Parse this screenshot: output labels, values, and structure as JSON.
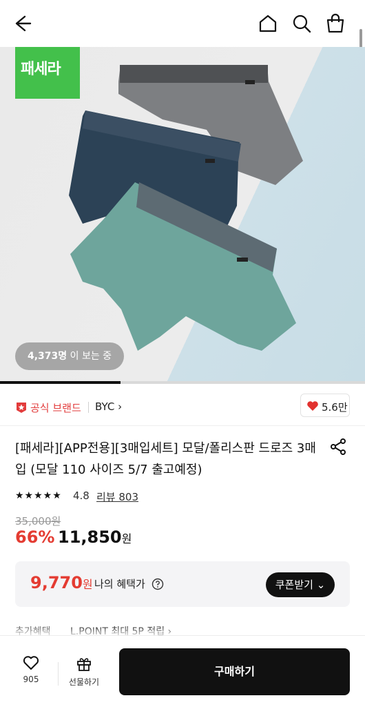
{
  "topbar": {
    "back_icon": "arrow-left-icon",
    "home_icon": "home-icon",
    "search_icon": "search-icon",
    "cart_icon": "shopping-bag-icon"
  },
  "hero": {
    "badge_text": "패세라",
    "badge_color": "#43c04b",
    "viewer_count": "4,373명",
    "viewer_suffix": " 이 보는 중",
    "image_progress": 0.33
  },
  "brand": {
    "official_label": "공식 브랜드",
    "official_color": "#e23b3b",
    "name": "BYC",
    "chevron": "›",
    "like_count": "5.6만",
    "heart_color": "#e2322f"
  },
  "product": {
    "title": "[패세라][APP전용][3매입세트] 모달/폴리스판 드로즈 3매입 (모달 110 사이즈 5/7 출고예정)",
    "rating_stars": "★★★★★",
    "rating_value": "4.8",
    "review_text": "리뷰 803",
    "original_price": "35,000원",
    "discount_rate": "66%",
    "sale_price": "11,850",
    "currency": "원",
    "accent_color": "#e43c32"
  },
  "benefit": {
    "price": "9,770",
    "currency": "원",
    "label": "나의 혜택가",
    "coupon_button": "쿠폰받기"
  },
  "extra": {
    "label": "추가혜택",
    "value": "L.POINT 최대 5P 적립 ›"
  },
  "bottom_bar": {
    "wish_count": "905",
    "gift_label": "선물하기",
    "buy_label": "구매하기"
  }
}
